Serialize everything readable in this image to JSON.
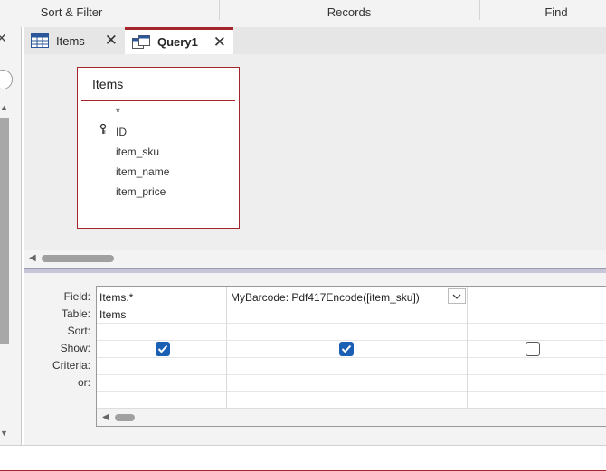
{
  "ribbon": {
    "groups": [
      "Sort & Filter",
      "Records",
      "Find"
    ]
  },
  "nav": {
    "close_icon": "close-icon",
    "search_icon": "search-icon"
  },
  "tabs": [
    {
      "label": "Items",
      "icon": "table-icon",
      "active": false
    },
    {
      "label": "Query1",
      "icon": "query-icon",
      "active": true
    }
  ],
  "design": {
    "table": {
      "title": "Items",
      "fields": [
        "*",
        "ID",
        "item_sku",
        "item_name",
        "item_price"
      ],
      "key_field": "ID"
    }
  },
  "grid": {
    "row_labels": [
      "Field:",
      "Table:",
      "Sort:",
      "Show:",
      "Criteria:",
      "or:"
    ],
    "columns": [
      {
        "field": "Items.*",
        "table": "Items",
        "sort": "",
        "show": true,
        "criteria": "",
        "or": ""
      },
      {
        "field": "MyBarcode: Pdf417Encode([item_sku])",
        "table": "",
        "sort": "",
        "show": true,
        "criteria": "",
        "or": ""
      },
      {
        "field": "",
        "table": "",
        "sort": "",
        "show": false,
        "criteria": "",
        "or": ""
      }
    ]
  },
  "colors": {
    "accent": "#a4262c",
    "checkbox_on": "#1a5fb4"
  }
}
